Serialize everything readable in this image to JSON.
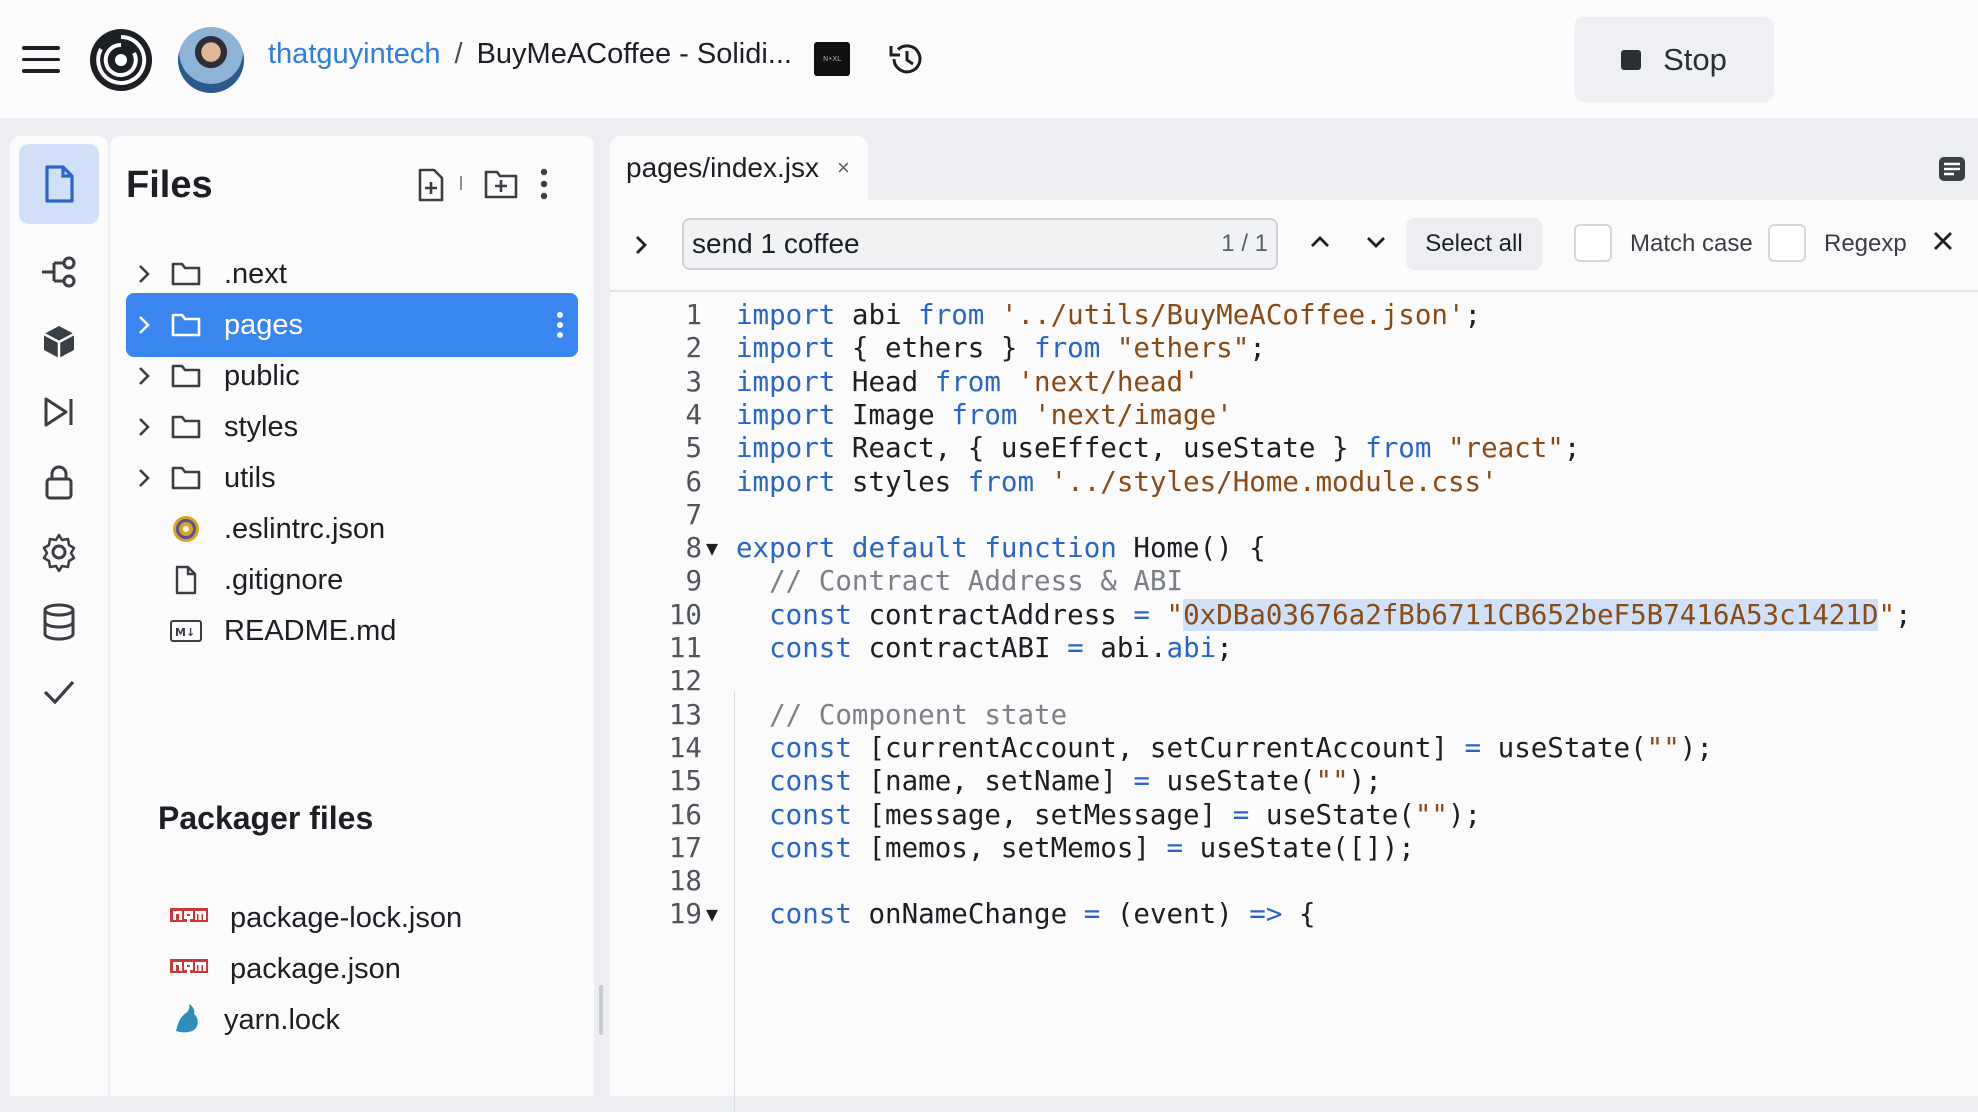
{
  "topbar": {
    "user": "thatguyintech",
    "separator": "/",
    "repl_title": "BuyMeACoffee - Solidi...",
    "stop_label": "Stop"
  },
  "files": {
    "title": "Files",
    "tree": [
      {
        "name": ".next",
        "type": "folder"
      },
      {
        "name": "pages",
        "type": "folder",
        "selected": true
      },
      {
        "name": "public",
        "type": "folder"
      },
      {
        "name": "styles",
        "type": "folder"
      },
      {
        "name": "utils",
        "type": "folder"
      },
      {
        "name": ".eslintrc.json",
        "type": "eslint"
      },
      {
        "name": ".gitignore",
        "type": "file"
      },
      {
        "name": "README.md",
        "type": "markdown"
      }
    ],
    "packager_title": "Packager files",
    "packager": [
      {
        "name": "package-lock.json",
        "icon": "npm-icon"
      },
      {
        "name": "package.json",
        "icon": "npm-icon"
      },
      {
        "name": "yarn.lock",
        "icon": "yarn-icon"
      }
    ]
  },
  "editor": {
    "tab_label": "pages/index.jsx",
    "tab_close": "×",
    "find": {
      "query": "send 1 coffee",
      "count": "1 / 1",
      "select_all": "Select all",
      "match_case": "Match case",
      "regexp": "Regexp"
    },
    "lines": [
      {
        "n": "1",
        "fold": "",
        "t": "import abi from '../utils/BuyMeACoffee.json';"
      },
      {
        "n": "2",
        "fold": "",
        "t": "import { ethers } from \"ethers\";"
      },
      {
        "n": "3",
        "fold": "",
        "t": "import Head from 'next/head'"
      },
      {
        "n": "4",
        "fold": "",
        "t": "import Image from 'next/image'"
      },
      {
        "n": "5",
        "fold": "",
        "t": "import React, { useEffect, useState } from \"react\";"
      },
      {
        "n": "6",
        "fold": "",
        "t": "import styles from '../styles/Home.module.css'"
      },
      {
        "n": "7",
        "fold": "",
        "t": ""
      },
      {
        "n": "8",
        "fold": "▼",
        "t": "export default function Home() {"
      },
      {
        "n": "9",
        "fold": "",
        "t": "  // Contract Address & ABI"
      },
      {
        "n": "10",
        "fold": "",
        "t": "  const contractAddress = \"0xDBa03676a2fBb6711CB652beF5B7416A53c1421D\";"
      },
      {
        "n": "11",
        "fold": "",
        "t": "  const contractABI = abi.abi;"
      },
      {
        "n": "12",
        "fold": "",
        "t": ""
      },
      {
        "n": "13",
        "fold": "",
        "t": "  // Component state"
      },
      {
        "n": "14",
        "fold": "",
        "t": "  const [currentAccount, setCurrentAccount] = useState(\"\");"
      },
      {
        "n": "15",
        "fold": "",
        "t": "  const [name, setName] = useState(\"\");"
      },
      {
        "n": "16",
        "fold": "",
        "t": "  const [message, setMessage] = useState(\"\");"
      },
      {
        "n": "17",
        "fold": "",
        "t": "  const [memos, setMemos] = useState([]);"
      },
      {
        "n": "18",
        "fold": "",
        "t": ""
      },
      {
        "n": "19",
        "fold": "▼",
        "t": "  const onNameChange = (event) => {"
      }
    ],
    "highlight": "0xDBa03676a2fBb6711CB652beF5B7416A53c1421D"
  },
  "colors": {
    "accent": "#3a86f0",
    "keyword": "#2a66c9",
    "string": "#8a4b14",
    "comment": "#7c8088",
    "selection": "#cfe0f8"
  }
}
